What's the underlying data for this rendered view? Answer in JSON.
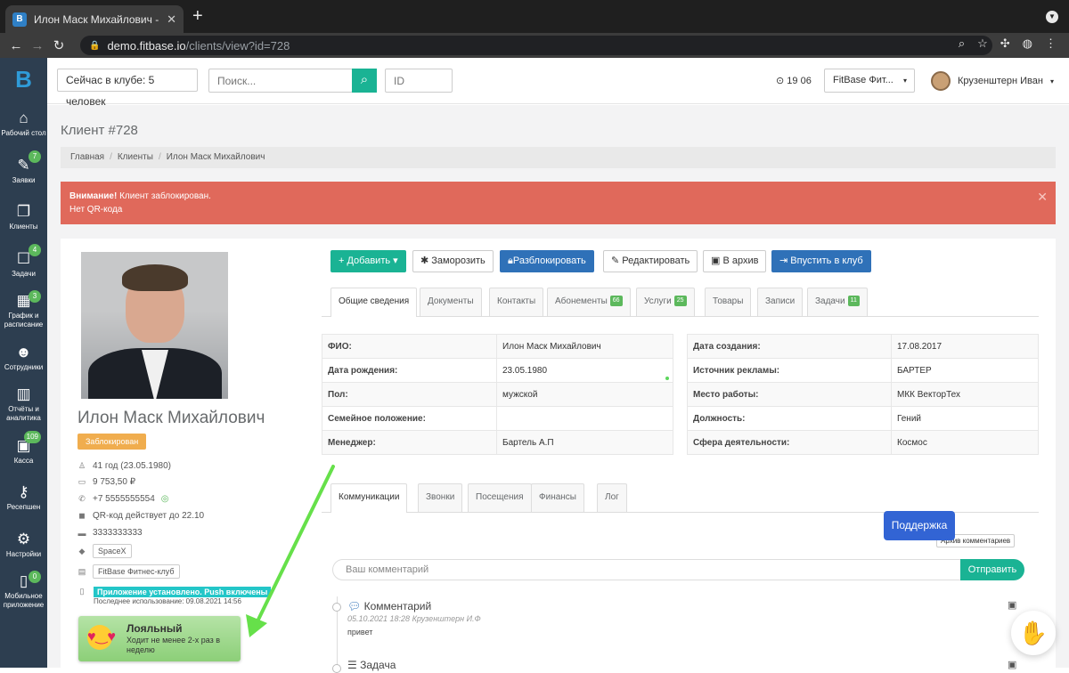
{
  "browser": {
    "tab_title": "Илон Маск Михайлович - Fitb",
    "url_host": "demo.fitbase.io",
    "url_path": "/clients/view?id=728",
    "favicon": "B"
  },
  "sidebar": {
    "logo": "B",
    "items": [
      {
        "label": "Рабочий стол",
        "icon": "home-icon",
        "glyph": "⌂",
        "badge": ""
      },
      {
        "label": "Заявки",
        "icon": "pencil-icon",
        "glyph": "✎",
        "badge": "7"
      },
      {
        "label": "Клиенты",
        "icon": "clients-icon",
        "glyph": "❐",
        "badge": ""
      },
      {
        "label": "Задачи",
        "icon": "tasks-icon",
        "glyph": "☐",
        "badge": "4"
      },
      {
        "label": "График и расписание",
        "icon": "calendar-icon",
        "glyph": "▦",
        "badge": "3"
      },
      {
        "label": "Сотрудники",
        "icon": "users-icon",
        "glyph": "☻",
        "badge": ""
      },
      {
        "label": "Отчёты и аналитика",
        "icon": "chart-icon",
        "glyph": "▥",
        "badge": ""
      },
      {
        "label": "Касса",
        "icon": "cash-icon",
        "glyph": "▣",
        "badge": "109"
      },
      {
        "label": "Ресепшен",
        "icon": "keys-icon",
        "glyph": "⚷",
        "badge": ""
      },
      {
        "label": "Настройки",
        "icon": "gear-icon",
        "glyph": "⚙",
        "badge": ""
      },
      {
        "label": "Мобильное приложение",
        "icon": "mobile-icon",
        "glyph": "▯",
        "badge": "0"
      }
    ]
  },
  "topbar": {
    "in_club": "Сейчас в клубе: 5 человек",
    "search_placeholder": "Поиск...",
    "id_placeholder": "ID",
    "clock": "19 06",
    "club_select": "FitBase Фит...",
    "user_name": "Крузенштерн Иван"
  },
  "page": {
    "title": "Клиент #728",
    "breadcrumb": [
      "Главная",
      "Клиенты",
      "Илон Маск Михайлович"
    ]
  },
  "alert": {
    "strong": "Внимание!",
    "text": " Клиент заблокирован.",
    "line2": "Нет QR-кода"
  },
  "client": {
    "name": "Илон Маск Михайлович",
    "status": "Заблокирован",
    "age": "41 год (23.05.1980)",
    "balance": "9 753,50 ₽",
    "phone": "+7 5555555554",
    "qr": "QR-код действует до 22.10",
    "card": "3333333333",
    "tag": "SpaceX",
    "club": "FitBase Фитнес-клуб",
    "app_status": "Приложение установлено. Push включены",
    "last_use": "Последнее использование: 09.08.2021 14:56",
    "loyalty_title": "Лояльный",
    "loyalty_text": "Ходит не менее 2-х раз в неделю"
  },
  "actions": [
    "Добавить",
    "Заморозить",
    "Разблокировать",
    "Редактировать",
    "В архив",
    "Впустить в клуб"
  ],
  "tabs": [
    {
      "label": "Общие сведения",
      "count": ""
    },
    {
      "label": "Документы",
      "count": ""
    },
    {
      "label": "Контакты",
      "count": ""
    },
    {
      "label": "Абонементы",
      "count": "66"
    },
    {
      "label": "Услуги",
      "count": "25"
    },
    {
      "label": "Товары",
      "count": ""
    },
    {
      "label": "Записи",
      "count": ""
    },
    {
      "label": "Задачи",
      "count": "11"
    }
  ],
  "info_left": [
    [
      "ФИО:",
      "Илон Маск Михайлович"
    ],
    [
      "Дата рождения:",
      "23.05.1980"
    ],
    [
      "Пол:",
      "мужской"
    ],
    [
      "Семейное положение:",
      ""
    ],
    [
      "Менеджер:",
      "Бартель А.П"
    ]
  ],
  "info_right": [
    [
      "Дата создания:",
      "17.08.2017"
    ],
    [
      "Источник рекламы:",
      "БАРТЕР"
    ],
    [
      "Место работы:",
      "МКК ВекторТех"
    ],
    [
      "Должность:",
      "Гений"
    ],
    [
      "Сфера деятельности:",
      "Космос"
    ]
  ],
  "subtabs": [
    "Коммуникации",
    "Звонки",
    "Посещения",
    "Финансы",
    "Лог"
  ],
  "comments": {
    "archive": "Архив комментариев",
    "placeholder": "Ваш комментарий",
    "send": "Отправить",
    "item_title": "Комментарий",
    "item_meta": "05.10.2021 18:28",
    "item_author": "Крузенштерн И.Ф",
    "item_body": "привет",
    "next_title": "Задача"
  },
  "support": "Поддержка",
  "colors": {
    "sidebar": "#2d3e50",
    "accent": "#1ab394",
    "alert": "#e0695b",
    "primary": "#2f71b8",
    "arrow": "#66e04a"
  }
}
